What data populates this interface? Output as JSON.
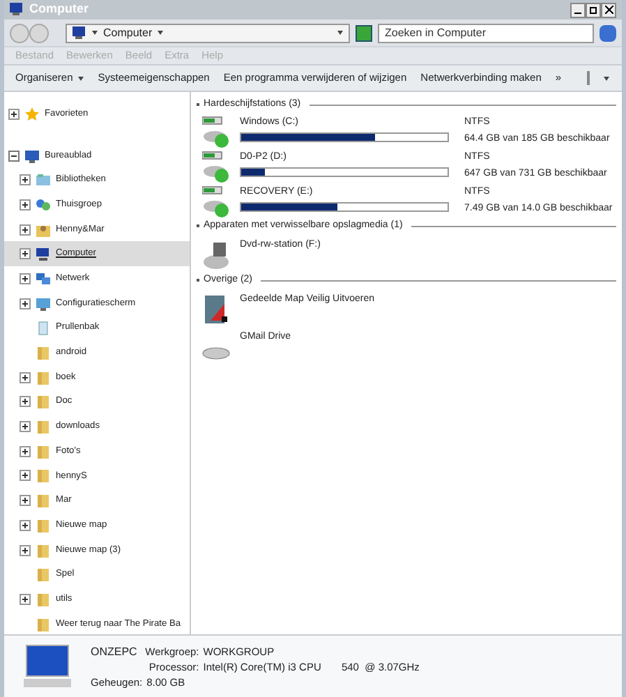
{
  "window": {
    "title": "Computer"
  },
  "address": {
    "crumbs": [
      "Computer"
    ]
  },
  "search": {
    "placeholder": "Zoeken in Computer"
  },
  "menu": [
    "Bestand",
    "Bewerken",
    "Beeld",
    "Extra",
    "Help"
  ],
  "toolbar": {
    "items": [
      {
        "label": "Organiseren",
        "dropdown": true
      },
      {
        "label": "Systeemeigenschappen",
        "dropdown": false
      },
      {
        "label": "Een programma verwijderen of wijzigen",
        "dropdown": false
      },
      {
        "label": "Netwerkverbinding maken",
        "dropdown": false
      }
    ],
    "more": "»"
  },
  "sidebar": {
    "items": [
      {
        "label": "Favorieten",
        "kind": "star",
        "expander": true,
        "expanded": false,
        "selected": false
      },
      {
        "label": "Bureaublad",
        "kind": "desktop",
        "expander": true,
        "expanded": true,
        "selected": false,
        "children": [
          {
            "label": "Bibliotheken",
            "kind": "library",
            "expander": true,
            "expanded": false,
            "selected": false
          },
          {
            "label": "Thuisgroep",
            "kind": "homegroup",
            "expander": true,
            "expanded": false,
            "selected": false
          },
          {
            "label": "Henny&Mar",
            "kind": "user",
            "expander": true,
            "expanded": false,
            "selected": false
          },
          {
            "label": "Computer",
            "kind": "computer",
            "expander": true,
            "expanded": false,
            "selected": true
          },
          {
            "label": "Netwerk",
            "kind": "network",
            "expander": true,
            "expanded": false,
            "selected": false
          },
          {
            "label": "Configuratiescherm",
            "kind": "control",
            "expander": true,
            "expanded": false,
            "selected": false
          },
          {
            "label": "Prullenbak",
            "kind": "bin",
            "expander": false,
            "expanded": false,
            "selected": false
          },
          {
            "label": "android",
            "kind": "folder",
            "expander": false,
            "expanded": false,
            "selected": false
          },
          {
            "label": "boek",
            "kind": "folder",
            "expander": true,
            "expanded": false,
            "selected": false
          },
          {
            "label": "Doc",
            "kind": "folder",
            "expander": true,
            "expanded": false,
            "selected": false
          },
          {
            "label": "downloads",
            "kind": "folder",
            "expander": true,
            "expanded": false,
            "selected": false
          },
          {
            "label": "Foto's",
            "kind": "folder",
            "expander": true,
            "expanded": false,
            "selected": false
          },
          {
            "label": "hennyS",
            "kind": "folder",
            "expander": true,
            "expanded": false,
            "selected": false
          },
          {
            "label": "Mar",
            "kind": "folder",
            "expander": true,
            "expanded": false,
            "selected": false
          },
          {
            "label": "Nieuwe map",
            "kind": "folder",
            "expander": true,
            "expanded": false,
            "selected": false
          },
          {
            "label": "Nieuwe map (3)",
            "kind": "folder",
            "expander": true,
            "expanded": false,
            "selected": false
          },
          {
            "label": "Spel",
            "kind": "folder",
            "expander": false,
            "expanded": false,
            "selected": false
          },
          {
            "label": "utils",
            "kind": "folder",
            "expander": true,
            "expanded": false,
            "selected": false
          },
          {
            "label": "Weer terug naar The Pirate Ba",
            "kind": "folder",
            "expander": false,
            "expanded": false,
            "selected": false
          }
        ]
      }
    ]
  },
  "groups": [
    {
      "title": "Hardeschijfstations (3)",
      "items": [
        {
          "kind": "disk",
          "name": "Windows (C:)",
          "fs": "NTFS",
          "free": "64.4 GB van 185 GB beschikbaar",
          "level": 0.65
        },
        {
          "kind": "disk",
          "name": "D0-P2 (D:)",
          "fs": "NTFS",
          "free": "647 GB van 731 GB beschikbaar",
          "level": 0.115
        },
        {
          "kind": "disk",
          "name": "RECOVERY (E:)",
          "fs": "NTFS",
          "free": "7.49 GB van 14.0 GB beschikbaar",
          "level": 0.465
        }
      ]
    },
    {
      "title": "Apparaten met verwisselbare opslagmedia (1)",
      "items": [
        {
          "kind": "dvd",
          "name": "Dvd-rw-station (F:)"
        }
      ]
    },
    {
      "title": "Overige (2)",
      "items": [
        {
          "kind": "shared",
          "name": "Gedeelde Map Veilig Uitvoeren"
        },
        {
          "kind": "drive",
          "name": "GMail Drive"
        }
      ]
    }
  ],
  "details": {
    "name": "ONZEPC",
    "fields": [
      {
        "label": "Werkgroep:",
        "value": "WORKGROUP"
      },
      {
        "label": "Processor:",
        "value": "Intel(R) Core(TM) i3 CPU       540  @ 3.07GHz"
      },
      {
        "label": "Geheugen:",
        "value": "8.00 GB"
      }
    ]
  }
}
